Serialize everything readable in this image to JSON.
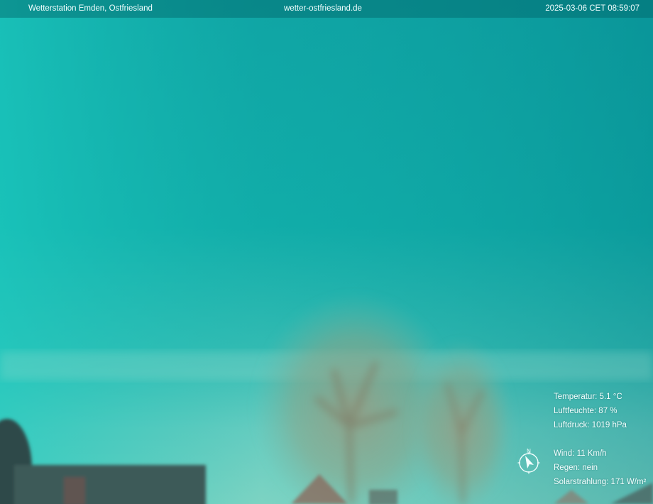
{
  "overlay": {
    "station_name": "Wetterstation Emden, Ostfriesland",
    "website": "wetter-ostfriesland.de",
    "timestamp": "2025-03-06 CET 08:59:07"
  },
  "weather": {
    "temperature": "Temperatur: 5.1 °C",
    "humidity": "Luftfeuchte: 87 %",
    "pressure": "Luftdruck: 1019 hPa",
    "wind": "Wind: 11 Km/h",
    "rain": "Regen: nein",
    "solar": "Solarstrahlung: 171 W/m²"
  },
  "compass": {
    "north_label": "N",
    "icon": "wind-direction-compass-icon"
  },
  "colors": {
    "sky_top": "#08979a",
    "sky_left": "#18c6bd",
    "horizon": "#8fd8cc",
    "tree": "#8a9a80",
    "text": "#f4ffff"
  }
}
